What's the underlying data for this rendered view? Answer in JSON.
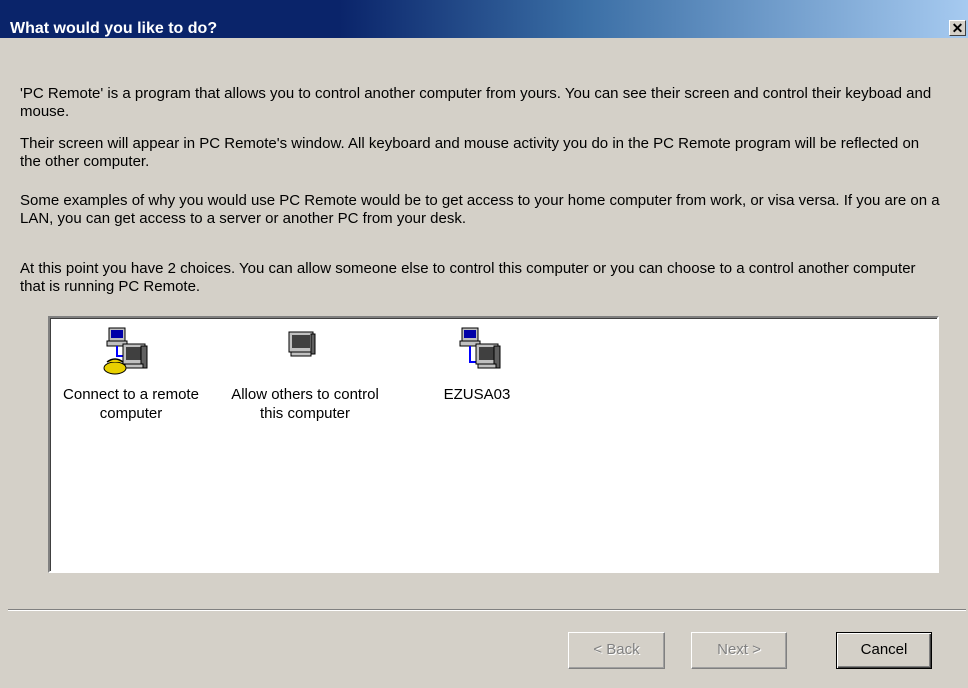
{
  "window": {
    "title": "What would you like to do?",
    "close_glyph": "✕"
  },
  "paragraphs": [
    "'PC Remote' is a program that allows you to control another computer from yours.  You can see their screen and control their keyboad and mouse.",
    "Their screen will appear in PC Remote's window.  All keyboard and mouse activity you do in the PC Remote program will be reflected on the other computer.",
    "Some examples of why you would use PC Remote would be to get access to your home computer from work, or visa versa.  If you are on a LAN, you can get access to a server or another PC from your desk.",
    "At this point you have 2 choices.  You can allow someone else to control this computer or you can choose to a control another computer that is running PC Remote."
  ],
  "choices": [
    {
      "label": "Connect to a remote computer",
      "icon": "networked-computer-phone-icon"
    },
    {
      "label": "Allow others to control this computer",
      "icon": "computer-monitor-icon"
    },
    {
      "label": "EZUSA03",
      "icon": "networked-computers-icon"
    }
  ],
  "buttons": {
    "back": "< Back",
    "next": "Next >",
    "cancel": "Cancel"
  },
  "colors": {
    "titlebar_start": "#0a246a",
    "titlebar_end": "#a6caf0",
    "dialog_bg": "#d4d0c8",
    "disabled_text": "#808080"
  }
}
